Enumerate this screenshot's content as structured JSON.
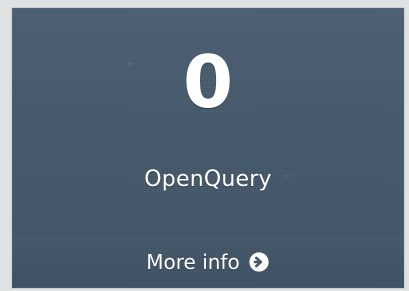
{
  "tile": {
    "count": "0",
    "label": "OpenQuery",
    "footer": {
      "label": "More info",
      "icon": "arrow-circle-right-icon"
    }
  },
  "colors": {
    "tile_background": "#44586b",
    "text": "#ffffff",
    "page_background": "#dfe2e2"
  }
}
